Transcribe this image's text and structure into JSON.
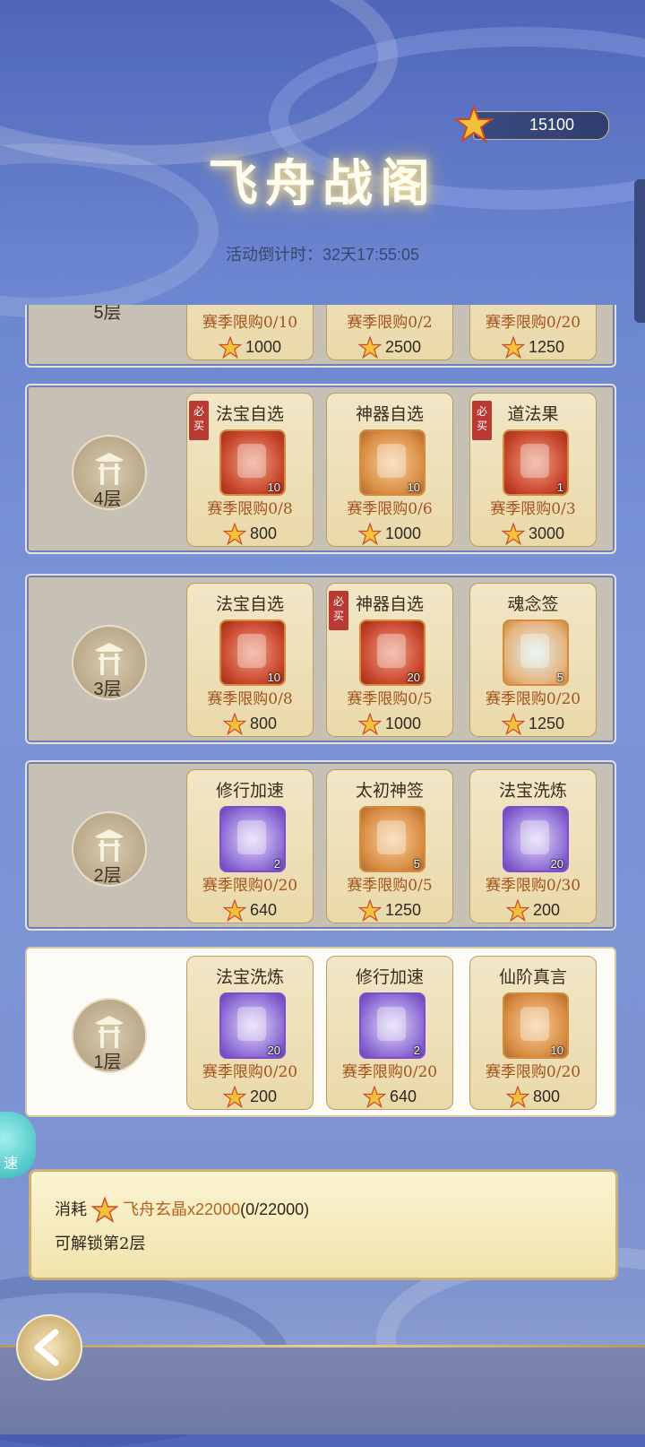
{
  "header": {
    "currency_value": "15100",
    "title": "飞舟战阁",
    "countdown_label": "活动倒计时：",
    "countdown_value": "32天17:55:05"
  },
  "floors": [
    {
      "label": "5层",
      "items": [
        {
          "limit": "赛季限购0/10",
          "price": "1000"
        },
        {
          "limit": "赛季限购0/2",
          "price": "2500"
        },
        {
          "limit": "赛季限购0/20",
          "price": "1250"
        }
      ]
    },
    {
      "label": "4层",
      "items": [
        {
          "name": "法宝自选",
          "qty": "10",
          "limit": "赛季限购0/8",
          "price": "800",
          "must_buy": "必买"
        },
        {
          "name": "神器自选",
          "qty": "10",
          "limit": "赛季限购0/6",
          "price": "1000"
        },
        {
          "name": "道法果",
          "qty": "1",
          "limit": "赛季限购0/3",
          "price": "3000",
          "must_buy": "必买"
        }
      ]
    },
    {
      "label": "3层",
      "items": [
        {
          "name": "法宝自选",
          "qty": "10",
          "limit": "赛季限购0/8",
          "price": "800"
        },
        {
          "name": "神器自选",
          "qty": "20",
          "limit": "赛季限购0/5",
          "price": "1000",
          "must_buy": "必买"
        },
        {
          "name": "魂念签",
          "qty": "5",
          "limit": "赛季限购0/20",
          "price": "1250"
        }
      ]
    },
    {
      "label": "2层",
      "items": [
        {
          "name": "修行加速",
          "qty": "2",
          "limit": "赛季限购0/20",
          "price": "640"
        },
        {
          "name": "太初神签",
          "qty": "5",
          "limit": "赛季限购0/5",
          "price": "1250"
        },
        {
          "name": "法宝洗炼",
          "qty": "20",
          "limit": "赛季限购0/30",
          "price": "200"
        }
      ]
    },
    {
      "label": "1层",
      "items": [
        {
          "name": "法宝洗炼",
          "qty": "20",
          "limit": "赛季限购0/20",
          "price": "200"
        },
        {
          "name": "修行加速",
          "qty": "2",
          "limit": "赛季限购0/20",
          "price": "640"
        },
        {
          "name": "仙阶真言",
          "qty": "10",
          "limit": "赛季限购0/20",
          "price": "800"
        }
      ]
    }
  ],
  "unlock": {
    "consume_label": "消耗",
    "item_name": "飞舟玄晶x22000",
    "progress": "(0/22000)",
    "line2": "可解锁第2层"
  },
  "speed_label": "速",
  "colors": {
    "accent_gold": "#e8c25a",
    "limit_text": "#a4521c",
    "must_buy_tag": "#b83a33"
  }
}
